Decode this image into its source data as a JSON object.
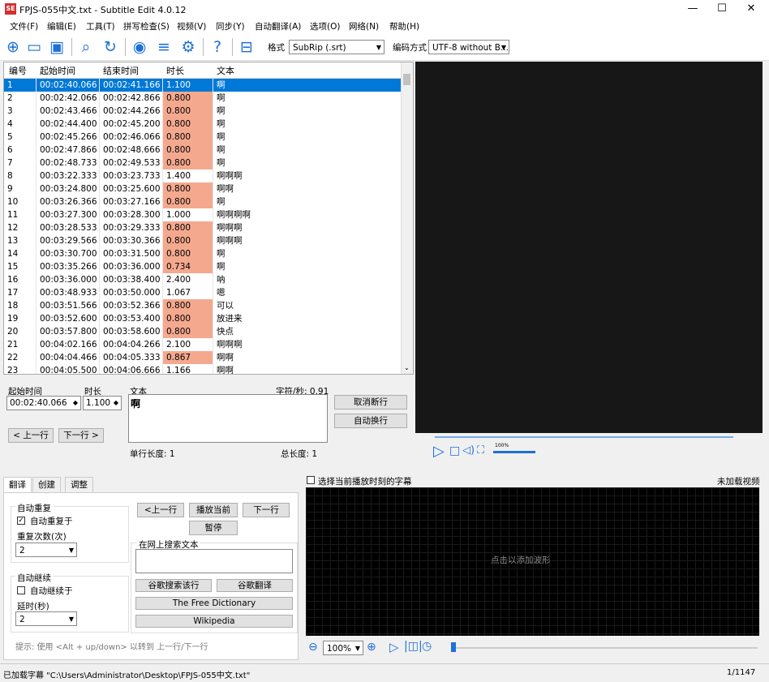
{
  "window": {
    "title": "FPJS-055中文.txt - Subtitle Edit 4.0.12",
    "icon_text": "SE",
    "min": "—",
    "max": "☐",
    "close": "✕"
  },
  "menu": [
    "文件(F)",
    "编辑(E)",
    "工具(T)",
    "拼写检查(S)",
    "视频(V)",
    "同步(Y)",
    "自动翻译(A)",
    "选项(O)",
    "网络(N)",
    "帮助(H)"
  ],
  "toolbar": {
    "format_label": "格式",
    "format_value": "SubRip (.srt)",
    "encoding_label": "编码方式",
    "encoding_value": "UTF-8 without B..."
  },
  "grid": {
    "headers": [
      "编号",
      "起始时间",
      "结束时间",
      "时长",
      "文本"
    ],
    "rows": [
      {
        "n": "1",
        "start": "00:02:40.066",
        "end": "00:02:41.166",
        "dur": "1.100",
        "text": "啊",
        "selected": true,
        "warn": false
      },
      {
        "n": "2",
        "start": "00:02:42.066",
        "end": "00:02:42.866",
        "dur": "0.800",
        "text": "啊",
        "warn": true
      },
      {
        "n": "3",
        "start": "00:02:43.466",
        "end": "00:02:44.266",
        "dur": "0.800",
        "text": "啊",
        "warn": true
      },
      {
        "n": "4",
        "start": "00:02:44.400",
        "end": "00:02:45.200",
        "dur": "0.800",
        "text": "啊",
        "warn": true
      },
      {
        "n": "5",
        "start": "00:02:45.266",
        "end": "00:02:46.066",
        "dur": "0.800",
        "text": "啊",
        "warn": true
      },
      {
        "n": "6",
        "start": "00:02:47.866",
        "end": "00:02:48.666",
        "dur": "0.800",
        "text": "啊",
        "warn": true
      },
      {
        "n": "7",
        "start": "00:02:48.733",
        "end": "00:02:49.533",
        "dur": "0.800",
        "text": "啊",
        "warn": true
      },
      {
        "n": "8",
        "start": "00:03:22.333",
        "end": "00:03:23.733",
        "dur": "1.400",
        "text": "啊啊啊",
        "warn": false
      },
      {
        "n": "9",
        "start": "00:03:24.800",
        "end": "00:03:25.600",
        "dur": "0.800",
        "text": "啊啊",
        "warn": true
      },
      {
        "n": "10",
        "start": "00:03:26.366",
        "end": "00:03:27.166",
        "dur": "0.800",
        "text": "啊",
        "warn": true
      },
      {
        "n": "11",
        "start": "00:03:27.300",
        "end": "00:03:28.300",
        "dur": "1.000",
        "text": "啊啊啊啊",
        "warn": false
      },
      {
        "n": "12",
        "start": "00:03:28.533",
        "end": "00:03:29.333",
        "dur": "0.800",
        "text": "啊啊啊",
        "warn": true
      },
      {
        "n": "13",
        "start": "00:03:29.566",
        "end": "00:03:30.366",
        "dur": "0.800",
        "text": "啊啊啊",
        "warn": true
      },
      {
        "n": "14",
        "start": "00:03:30.700",
        "end": "00:03:31.500",
        "dur": "0.800",
        "text": "啊",
        "warn": true
      },
      {
        "n": "15",
        "start": "00:03:35.266",
        "end": "00:03:36.000",
        "dur": "0.734",
        "text": "啊",
        "warn": true
      },
      {
        "n": "16",
        "start": "00:03:36.000",
        "end": "00:03:38.400",
        "dur": "2.400",
        "text": "呐",
        "warn": false
      },
      {
        "n": "17",
        "start": "00:03:48.933",
        "end": "00:03:50.000",
        "dur": "1.067",
        "text": "嗯",
        "warn": false
      },
      {
        "n": "18",
        "start": "00:03:51.566",
        "end": "00:03:52.366",
        "dur": "0.800",
        "text": "可以",
        "warn": true
      },
      {
        "n": "19",
        "start": "00:03:52.600",
        "end": "00:03:53.400",
        "dur": "0.800",
        "text": "放进来",
        "warn": true
      },
      {
        "n": "20",
        "start": "00:03:57.800",
        "end": "00:03:58.600",
        "dur": "0.800",
        "text": "快点",
        "warn": true
      },
      {
        "n": "21",
        "start": "00:04:02.166",
        "end": "00:04:04.266",
        "dur": "2.100",
        "text": "啊啊啊",
        "warn": false
      },
      {
        "n": "22",
        "start": "00:04:04.466",
        "end": "00:04:05.333",
        "dur": "0.867",
        "text": "啊啊",
        "warn": true
      },
      {
        "n": "23",
        "start": "00:04:05.500",
        "end": "00:04:06.666",
        "dur": "1.166",
        "text": "啊啊",
        "warn": false
      }
    ]
  },
  "editor": {
    "start_label": "起始时间",
    "start_value": "00:02:40.066",
    "dur_label": "时长",
    "dur_value": "1.100",
    "text_label": "文本",
    "cps": "字符/秒: 0.91",
    "text_value": "啊",
    "line_len": "单行长度: 1",
    "total_len": "总长度: 1",
    "btn_unbreak": "取消断行",
    "btn_autobr": "自动换行",
    "btn_prev": "< 上一行",
    "btn_next": "下一行 >"
  },
  "video": {
    "zoom_label": "100%"
  },
  "tabs": [
    "翻译",
    "创建",
    "调整"
  ],
  "translate": {
    "auto_repeat_group": "自动重复",
    "auto_repeat_on": "自动重复于",
    "repeat_count_label": "重复次数(次)",
    "repeat_count": "2",
    "auto_continue_group": "自动继续",
    "auto_continue_on": "自动继续于",
    "delay_label": "延时(秒)",
    "delay": "2",
    "prev": "<上一行",
    "play_current": "播放当前",
    "next": "下一行",
    "pause": "暂停",
    "search_group": "在网上搜索文本",
    "google_search": "谷歌搜索该行",
    "google_translate": "谷歌翻译",
    "free_dict": "The Free Dictionary",
    "wikipedia": "Wikipedia",
    "hint": "提示: 使用 <Alt + up/down> 以转到 上一行/下一行"
  },
  "waveform": {
    "select_current": "选择当前播放时刻的字幕",
    "no_video": "未加载视频",
    "click_to_add": "点击以添加波形",
    "zoom": "100%"
  },
  "status": {
    "loaded": "已加载字幕 \"C:\\Users\\Administrator\\Desktop\\FPJS-055中文.txt\"",
    "position": "1/1147"
  },
  "colors": {
    "accent": "#0078d7",
    "warn": "#f4a98f",
    "icon": "#1e6fd9"
  }
}
